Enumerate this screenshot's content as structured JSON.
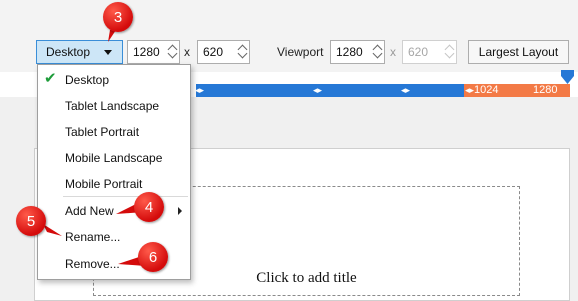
{
  "toolbar": {
    "device_label": "Desktop",
    "width_value": "1280",
    "height_value": "620",
    "times_symbol": "x",
    "viewport_label": "Viewport",
    "viewport_width": "1280",
    "viewport_times": "x",
    "viewport_height": "620",
    "largest_layout_label": "Largest Layout"
  },
  "ruler": {
    "breakpoint_low": "1024",
    "breakpoint_high": "1280",
    "colors": {
      "base": "#2678d6",
      "active": "#f37a46"
    }
  },
  "menu": {
    "items": [
      {
        "label": "Desktop",
        "checked": true
      },
      {
        "label": "Tablet Landscape"
      },
      {
        "label": "Tablet Portrait"
      },
      {
        "label": "Mobile Landscape"
      },
      {
        "label": "Mobile Portrait"
      },
      {
        "label": "Add New",
        "has_submenu": true
      },
      {
        "label": "Rename..."
      },
      {
        "label": "Remove..."
      }
    ]
  },
  "canvas": {
    "title_placeholder": "Click to add title"
  },
  "callouts": [
    "3",
    "4",
    "5",
    "6"
  ],
  "colors": {
    "callout": "#d40b0b",
    "selected_device": "#cde6f7",
    "check": "#1e9c3a"
  }
}
